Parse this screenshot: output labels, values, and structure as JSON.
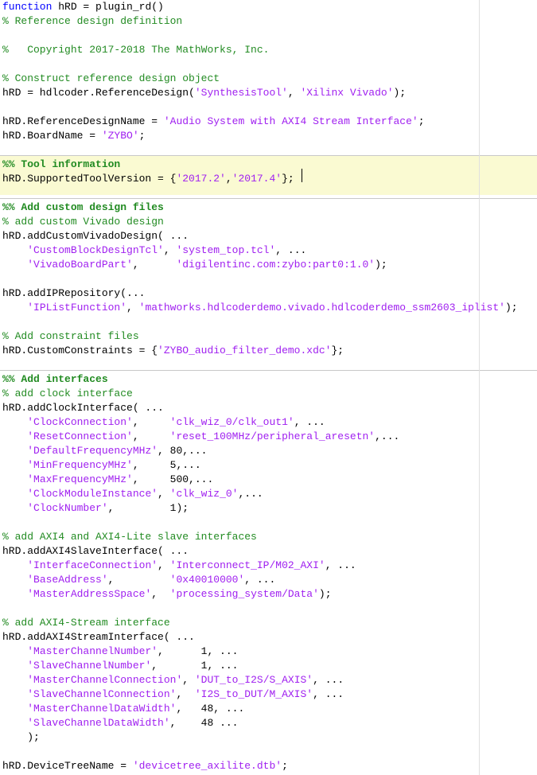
{
  "editor": {
    "lines": [
      [
        {
          "t": "function",
          "c": "kw"
        },
        {
          "t": " hRD = plugin_rd()",
          "c": ""
        }
      ],
      [
        {
          "t": "% Reference design definition",
          "c": "cm"
        }
      ],
      [],
      [
        {
          "t": "%   Copyright 2017-2018 The MathWorks, Inc.",
          "c": "cm"
        }
      ],
      [],
      [
        {
          "t": "% Construct reference design object",
          "c": "cm"
        }
      ],
      [
        {
          "t": "hRD = hdlcoder.ReferenceDesign(",
          "c": ""
        },
        {
          "t": "'SynthesisTool'",
          "c": "st"
        },
        {
          "t": ", ",
          "c": ""
        },
        {
          "t": "'Xilinx Vivado'",
          "c": "st"
        },
        {
          "t": ");",
          "c": ""
        }
      ],
      [],
      [
        {
          "t": "hRD.ReferenceDesignName = ",
          "c": ""
        },
        {
          "t": "'Audio System with AXI4 Stream Interface'",
          "c": "st"
        },
        {
          "t": ";",
          "c": ""
        }
      ],
      [
        {
          "t": "hRD.BoardName = ",
          "c": ""
        },
        {
          "t": "'ZYBO'",
          "c": "st"
        },
        {
          "t": ";",
          "c": ""
        }
      ],
      [],
      [
        {
          "t": "%% Tool information",
          "c": "cell-cm"
        }
      ],
      [
        {
          "t": "hRD.SupportedToolVersion = {",
          "c": ""
        },
        {
          "t": "'2017.2'",
          "c": "st"
        },
        {
          "t": ",",
          "c": ""
        },
        {
          "t": "'2017.4'",
          "c": "st"
        },
        {
          "t": "};",
          "c": ""
        }
      ],
      [],
      [
        {
          "t": "%% Add custom design files",
          "c": "cell-cm"
        }
      ],
      [
        {
          "t": "% add custom Vivado design",
          "c": "cm"
        }
      ],
      [
        {
          "t": "hRD.addCustomVivadoDesign( ...",
          "c": ""
        }
      ],
      [
        {
          "t": "    ",
          "c": ""
        },
        {
          "t": "'CustomBlockDesignTcl'",
          "c": "st"
        },
        {
          "t": ", ",
          "c": ""
        },
        {
          "t": "'system_top.tcl'",
          "c": "st"
        },
        {
          "t": ", ...",
          "c": ""
        }
      ],
      [
        {
          "t": "    ",
          "c": ""
        },
        {
          "t": "'VivadoBoardPart'",
          "c": "st"
        },
        {
          "t": ",      ",
          "c": ""
        },
        {
          "t": "'digilentinc.com:zybo:part0:1.0'",
          "c": "st"
        },
        {
          "t": ");",
          "c": ""
        }
      ],
      [],
      [
        {
          "t": "hRD.addIPRepository(...",
          "c": ""
        }
      ],
      [
        {
          "t": "    ",
          "c": ""
        },
        {
          "t": "'IPListFunction'",
          "c": "st"
        },
        {
          "t": ", ",
          "c": ""
        },
        {
          "t": "'mathworks.hdlcoderdemo.vivado.hdlcoderdemo_ssm2603_iplist'",
          "c": "st"
        },
        {
          "t": ");",
          "c": ""
        }
      ],
      [],
      [
        {
          "t": "% Add constraint files",
          "c": "cm"
        }
      ],
      [
        {
          "t": "hRD.CustomConstraints = {",
          "c": ""
        },
        {
          "t": "'ZYBO_audio_filter_demo.xdc'",
          "c": "st"
        },
        {
          "t": "};",
          "c": ""
        }
      ],
      [],
      [
        {
          "t": "%% Add interfaces",
          "c": "cell-cm"
        }
      ],
      [
        {
          "t": "% add clock interface",
          "c": "cm"
        }
      ],
      [
        {
          "t": "hRD.addClockInterface( ...",
          "c": ""
        }
      ],
      [
        {
          "t": "    ",
          "c": ""
        },
        {
          "t": "'ClockConnection'",
          "c": "st"
        },
        {
          "t": ",     ",
          "c": ""
        },
        {
          "t": "'clk_wiz_0/clk_out1'",
          "c": "st"
        },
        {
          "t": ", ...",
          "c": ""
        }
      ],
      [
        {
          "t": "    ",
          "c": ""
        },
        {
          "t": "'ResetConnection'",
          "c": "st"
        },
        {
          "t": ",     ",
          "c": ""
        },
        {
          "t": "'reset_100MHz/peripheral_aresetn'",
          "c": "st"
        },
        {
          "t": ",...",
          "c": ""
        }
      ],
      [
        {
          "t": "    ",
          "c": ""
        },
        {
          "t": "'DefaultFrequencyMHz'",
          "c": "st"
        },
        {
          "t": ", 80,...",
          "c": ""
        }
      ],
      [
        {
          "t": "    ",
          "c": ""
        },
        {
          "t": "'MinFrequencyMHz'",
          "c": "st"
        },
        {
          "t": ",     5,...",
          "c": ""
        }
      ],
      [
        {
          "t": "    ",
          "c": ""
        },
        {
          "t": "'MaxFrequencyMHz'",
          "c": "st"
        },
        {
          "t": ",     500,...",
          "c": ""
        }
      ],
      [
        {
          "t": "    ",
          "c": ""
        },
        {
          "t": "'ClockModuleInstance'",
          "c": "st"
        },
        {
          "t": ", ",
          "c": ""
        },
        {
          "t": "'clk_wiz_0'",
          "c": "st"
        },
        {
          "t": ",...",
          "c": ""
        }
      ],
      [
        {
          "t": "    ",
          "c": ""
        },
        {
          "t": "'ClockNumber'",
          "c": "st"
        },
        {
          "t": ",         1);",
          "c": ""
        }
      ],
      [],
      [
        {
          "t": "% add AXI4 and AXI4-Lite slave interfaces",
          "c": "cm"
        }
      ],
      [
        {
          "t": "hRD.addAXI4SlaveInterface( ...",
          "c": ""
        }
      ],
      [
        {
          "t": "    ",
          "c": ""
        },
        {
          "t": "'InterfaceConnection'",
          "c": "st"
        },
        {
          "t": ", ",
          "c": ""
        },
        {
          "t": "'Interconnect_IP/M02_AXI'",
          "c": "st"
        },
        {
          "t": ", ...",
          "c": ""
        }
      ],
      [
        {
          "t": "    ",
          "c": ""
        },
        {
          "t": "'BaseAddress'",
          "c": "st"
        },
        {
          "t": ",         ",
          "c": ""
        },
        {
          "t": "'0x40010000'",
          "c": "st"
        },
        {
          "t": ", ...",
          "c": ""
        }
      ],
      [
        {
          "t": "    ",
          "c": ""
        },
        {
          "t": "'MasterAddressSpace'",
          "c": "st"
        },
        {
          "t": ",  ",
          "c": ""
        },
        {
          "t": "'processing_system/Data'",
          "c": "st"
        },
        {
          "t": ");",
          "c": ""
        }
      ],
      [],
      [
        {
          "t": "% add AXI4-Stream interface",
          "c": "cm"
        }
      ],
      [
        {
          "t": "hRD.addAXI4StreamInterface( ...",
          "c": ""
        }
      ],
      [
        {
          "t": "    ",
          "c": ""
        },
        {
          "t": "'MasterChannelNumber'",
          "c": "st"
        },
        {
          "t": ",      1, ...",
          "c": ""
        }
      ],
      [
        {
          "t": "    ",
          "c": ""
        },
        {
          "t": "'SlaveChannelNumber'",
          "c": "st"
        },
        {
          "t": ",       1, ...",
          "c": ""
        }
      ],
      [
        {
          "t": "    ",
          "c": ""
        },
        {
          "t": "'MasterChannelConnection'",
          "c": "st"
        },
        {
          "t": ", ",
          "c": ""
        },
        {
          "t": "'DUT_to_I2S/S_AXIS'",
          "c": "st"
        },
        {
          "t": ", ...",
          "c": ""
        }
      ],
      [
        {
          "t": "    ",
          "c": ""
        },
        {
          "t": "'SlaveChannelConnection'",
          "c": "st"
        },
        {
          "t": ",  ",
          "c": ""
        },
        {
          "t": "'I2S_to_DUT/M_AXIS'",
          "c": "st"
        },
        {
          "t": ", ...",
          "c": ""
        }
      ],
      [
        {
          "t": "    ",
          "c": ""
        },
        {
          "t": "'MasterChannelDataWidth'",
          "c": "st"
        },
        {
          "t": ",   48, ...",
          "c": ""
        }
      ],
      [
        {
          "t": "    ",
          "c": ""
        },
        {
          "t": "'SlaveChannelDataWidth'",
          "c": "st"
        },
        {
          "t": ",    48 ...",
          "c": ""
        }
      ],
      [
        {
          "t": "    );",
          "c": ""
        }
      ],
      [],
      [
        {
          "t": "hRD.DeviceTreeName = ",
          "c": ""
        },
        {
          "t": "'devicetree_axilite.dtb'",
          "c": "st"
        },
        {
          "t": ";",
          "c": ""
        }
      ]
    ]
  }
}
